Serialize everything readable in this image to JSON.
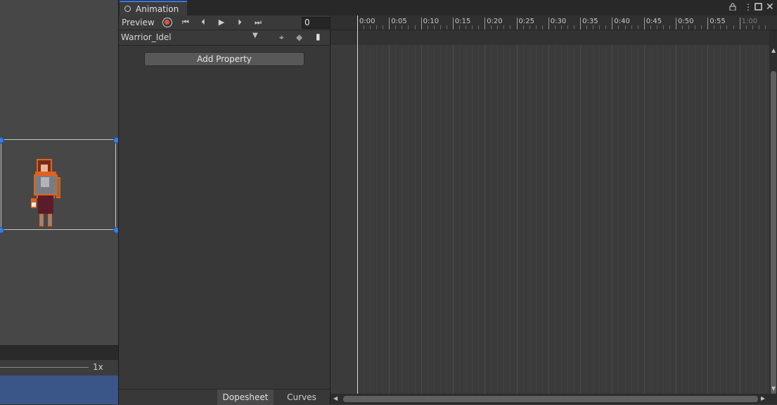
{
  "window": {
    "tab_label": "Animation",
    "icons": [
      "lock-icon",
      "menu-dots-icon",
      "maximize-icon",
      "close-icon",
      "more-icon"
    ]
  },
  "toolbar": {
    "preview_label": "Preview",
    "frame_value": "0",
    "clip_name": "Warrior_Idel",
    "add_property_label": "Add Property",
    "playback_icons": [
      "record-icon",
      "first-key-icon",
      "prev-key-icon",
      "play-icon",
      "next-key-icon",
      "last-key-icon"
    ]
  },
  "timeline": {
    "tick_labels": [
      "0:00",
      "0:05",
      "0:10",
      "0:15",
      "0:20",
      "0:25",
      "0:30",
      "0:35",
      "0:40",
      "0:45",
      "0:50",
      "0:55",
      "1:00"
    ]
  },
  "bottom_tabs": {
    "dopesheet": "Dopesheet",
    "curves": "Curves"
  },
  "scene": {
    "zoom_label": "1x"
  },
  "colors": {
    "accent": "#3a79d9",
    "record": "#e2543c",
    "handle": "#3b7ddd"
  }
}
